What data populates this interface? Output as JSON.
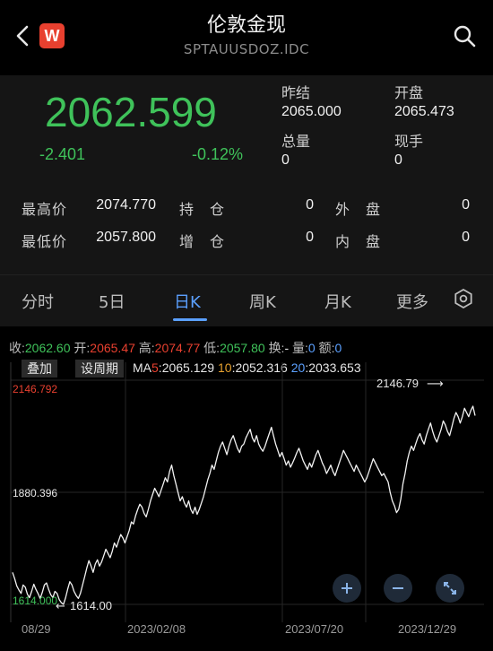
{
  "header": {
    "title": "伦敦金现",
    "subtitle": "SPTAUUSDOZ.IDC",
    "logo_letter": "W"
  },
  "quote": {
    "price": "2062.599",
    "change": "-2.401",
    "change_pct": "-0.12%",
    "prev_close_label": "昨结",
    "prev_close": "2065.000",
    "open_label": "开盘",
    "open": "2065.473",
    "volume_label": "总量",
    "volume": "0",
    "current_volume_label": "现手",
    "current_volume": "0"
  },
  "stats": {
    "high_label": "最高价",
    "high": "2074.770",
    "low_label": "最低价",
    "low": "2057.800",
    "position_label": "持　仓",
    "position": "0",
    "increase_label": "增　仓",
    "increase": "0",
    "outer_label": "外　盘",
    "outer": "0",
    "inner_label": "内　盘",
    "inner": "0"
  },
  "tabs": [
    {
      "label": "分时"
    },
    {
      "label": "5日"
    },
    {
      "label": "日K"
    },
    {
      "label": "周K"
    },
    {
      "label": "月K"
    },
    {
      "label": "更多"
    }
  ],
  "info": {
    "close_label": "收:",
    "close": "2062.60",
    "open_label": "开:",
    "open": "2065.47",
    "high_label": "高:",
    "high": "2074.77",
    "low_label": "低:",
    "low": "2057.80",
    "turnover_label": "换:",
    "turnover": "-",
    "vol_label": "量:",
    "vol": "0",
    "amount_label": "额:",
    "amount": "0"
  },
  "ma": {
    "overlay_label": "叠加",
    "period_label": "设周期",
    "prefix": "MA",
    "ma5_label": "5",
    "ma5": "2065.129",
    "ma10_label": "10",
    "ma10": "2052.316",
    "ma20_label": "20",
    "ma20": "2033.653"
  },
  "colors": {
    "up": "#e8402f",
    "down": "#3fc25a",
    "accent": "#5ba0ff",
    "ma10": "#e6a12f"
  },
  "chart_data": {
    "type": "line",
    "y_labels": [
      "2146.792",
      "1880.396",
      "1614.000"
    ],
    "ylim": [
      1614.0,
      2146.792
    ],
    "annot_max": "2146.79",
    "annot_min": "1614.00",
    "x_labels": [
      "08/29",
      "2023/02/08",
      "2023/07/20",
      "2023/12/29"
    ],
    "series": [
      {
        "values": [
          1690,
          1675,
          1658,
          1648,
          1640,
          1660,
          1655,
          1638,
          1630,
          1645,
          1662,
          1650,
          1640,
          1628,
          1642,
          1660,
          1665,
          1650,
          1637,
          1630,
          1645,
          1640,
          1625,
          1618,
          1614,
          1630,
          1650,
          1668,
          1660,
          1645,
          1635,
          1628,
          1640,
          1660,
          1680,
          1700,
          1718,
          1705,
          1690,
          1710,
          1720,
          1705,
          1715,
          1730,
          1745,
          1735,
          1725,
          1740,
          1760,
          1750,
          1765,
          1780,
          1772,
          1760,
          1775,
          1790,
          1810,
          1805,
          1825,
          1840,
          1852,
          1845,
          1830,
          1822,
          1840,
          1860,
          1875,
          1890,
          1880,
          1870,
          1885,
          1900,
          1915,
          1905,
          1930,
          1945,
          1920,
          1900,
          1880,
          1860,
          1870,
          1855,
          1845,
          1860,
          1840,
          1830,
          1845,
          1828,
          1840,
          1855,
          1870,
          1890,
          1910,
          1925,
          1945,
          1935,
          1955,
          1975,
          1990,
          2000,
          1985,
          1970,
          1990,
          2005,
          2015,
          2000,
          1985,
          1975,
          1990,
          1995,
          2010,
          2020,
          2030,
          2010,
          2000,
          2015,
          1995,
          1985,
          1978,
          1990,
          2005,
          2020,
          2035,
          2015,
          1995,
          1980,
          1965,
          1975,
          1960,
          1945,
          1955,
          1940,
          1950,
          1962,
          1975,
          1985,
          1970,
          1955,
          1945,
          1935,
          1950,
          1940,
          1955,
          1970,
          1980,
          1965,
          1950,
          1940,
          1925,
          1935,
          1945,
          1930,
          1920,
          1935,
          1950,
          1965,
          1980,
          1970,
          1960,
          1950,
          1940,
          1930,
          1945,
          1935,
          1925,
          1915,
          1905,
          1915,
          1930,
          1945,
          1960,
          1950,
          1940,
          1930,
          1920,
          1925,
          1915,
          1905,
          1880,
          1860,
          1848,
          1832,
          1840,
          1865,
          1900,
          1925,
          1955,
          1975,
          1990,
          1980,
          1995,
          2010,
          2020,
          2005,
          1995,
          2015,
          2030,
          2045,
          2025,
          2010,
          2000,
          2015,
          2030,
          2050,
          2040,
          2025,
          2015,
          2035,
          2055,
          2070,
          2060,
          2045,
          2060,
          2080,
          2070,
          2060,
          2075,
          2085,
          2062.6
        ]
      }
    ]
  }
}
